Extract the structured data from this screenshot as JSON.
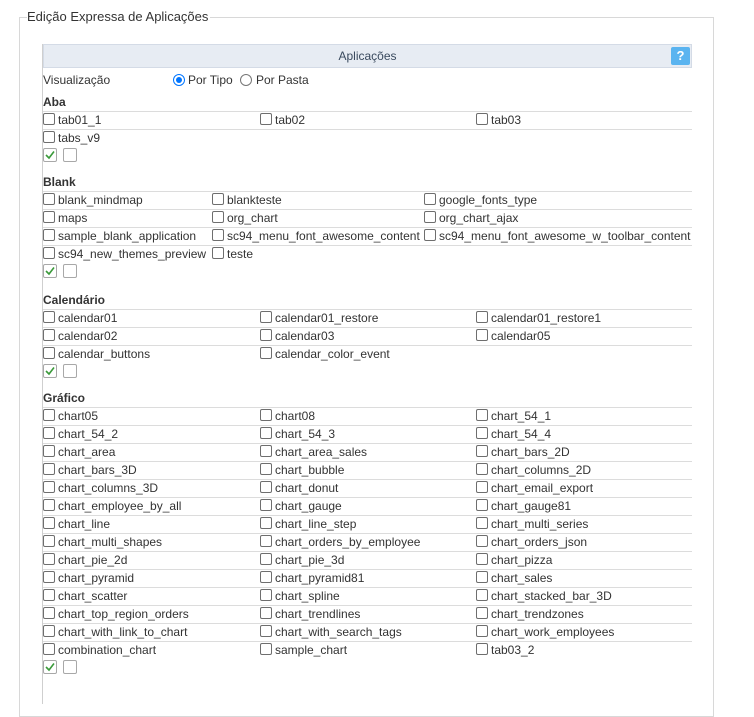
{
  "fieldset": {
    "legend": "Edição Expressa de Aplicações"
  },
  "panel": {
    "title": "Aplicações",
    "help_label": "?"
  },
  "visualizacao": {
    "label": "Visualização",
    "options": [
      "Por Tipo",
      "Por Pasta"
    ],
    "selected": "Por Tipo"
  },
  "sections": [
    {
      "title": "Aba",
      "items": [
        "tab01_1",
        "tab02",
        "tab03",
        "tabs_v9"
      ]
    },
    {
      "title": "Blank",
      "items": [
        "blank_mindmap",
        "blankteste",
        "google_fonts_type",
        "maps",
        "org_chart",
        "org_chart_ajax",
        "sample_blank_application",
        "sc94_menu_font_awesome_content",
        "sc94_menu_font_awesome_w_toolbar_content",
        "sc94_new_themes_preview",
        "teste"
      ]
    },
    {
      "title": "Calendário",
      "items": [
        "calendar01",
        "calendar01_restore",
        "calendar01_restore1",
        "calendar02",
        "calendar03",
        "calendar05",
        "calendar_buttons",
        "calendar_color_event"
      ]
    },
    {
      "title": "Gráfico",
      "items": [
        "chart05",
        "chart08",
        "chart_54_1",
        "chart_54_2",
        "chart_54_3",
        "chart_54_4",
        "chart_area",
        "chart_area_sales",
        "chart_bars_2D",
        "chart_bars_3D",
        "chart_bubble",
        "chart_columns_2D",
        "chart_columns_3D",
        "chart_donut",
        "chart_email_export",
        "chart_employee_by_all",
        "chart_gauge",
        "chart_gauge81",
        "chart_line",
        "chart_line_step",
        "chart_multi_series",
        "chart_multi_shapes",
        "chart_orders_by_employee",
        "chart_orders_json",
        "chart_pie_2d",
        "chart_pie_3d",
        "chart_pizza",
        "chart_pyramid",
        "chart_pyramid81",
        "chart_sales",
        "chart_scatter",
        "chart_spline",
        "chart_stacked_bar_3D",
        "chart_top_region_orders",
        "chart_trendlines",
        "chart_trendzones",
        "chart_with_link_to_chart",
        "chart_with_search_tags",
        "chart_work_employees",
        "combination_chart",
        "sample_chart",
        "tab03_2"
      ]
    }
  ],
  "colors": {
    "accent": "#0075ff",
    "help": "#5ab4f0",
    "header_bg": "#e7ecf3",
    "check": "#3a9a3a"
  },
  "icons": {
    "select_all": "check-icon",
    "select_none": "empty-box-icon"
  }
}
